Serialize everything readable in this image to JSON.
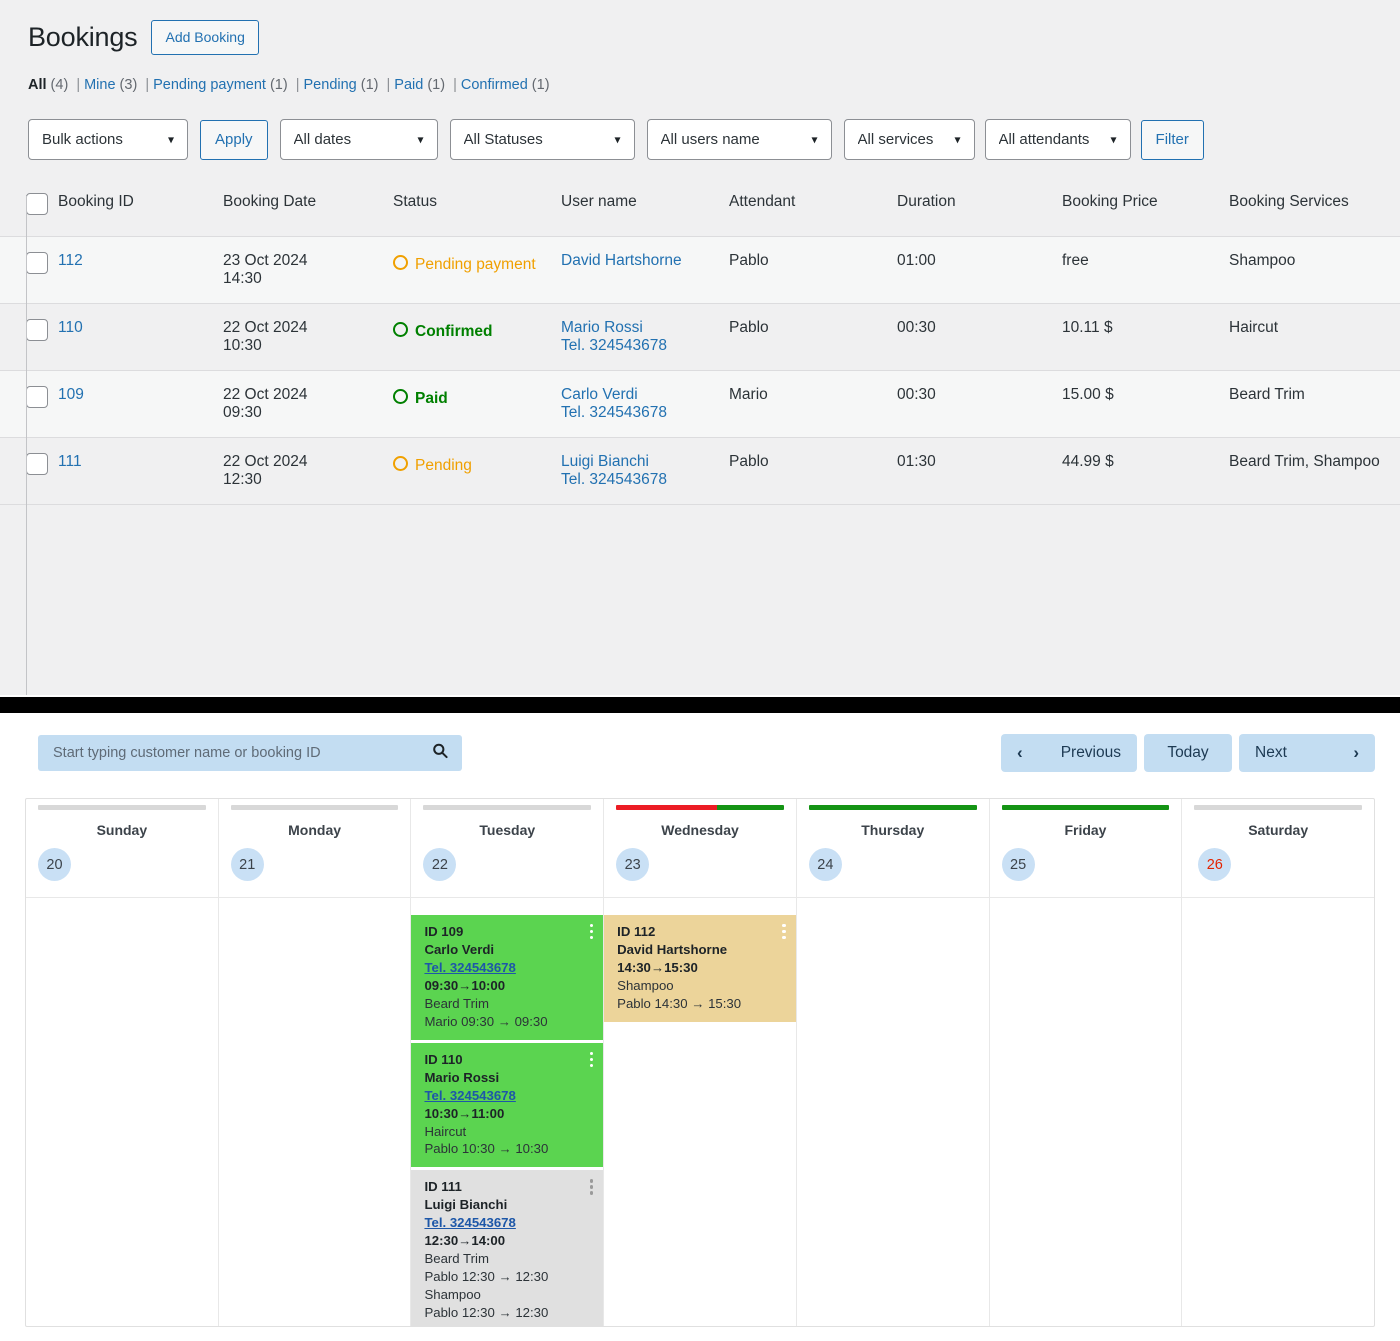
{
  "header": {
    "title": "Bookings",
    "add_button": "Add Booking"
  },
  "views": {
    "items": [
      {
        "label": "All",
        "count": "(4)",
        "current": true
      },
      {
        "label": "Mine",
        "count": "(3)",
        "current": false
      },
      {
        "label": "Pending payment",
        "count": "(1)",
        "current": false
      },
      {
        "label": "Pending",
        "count": "(1)",
        "current": false
      },
      {
        "label": "Paid",
        "count": "(1)",
        "current": false
      },
      {
        "label": "Confirmed",
        "count": "(1)",
        "current": false
      }
    ],
    "separator": "|"
  },
  "toolbar": {
    "bulk_actions": "Bulk actions",
    "apply": "Apply",
    "all_dates": "All dates",
    "all_statuses": "All Statuses",
    "all_users": "All users name",
    "all_services": "All services",
    "all_attendants": "All attendants",
    "filter": "Filter",
    "caret_icon": "chevron-down-icon"
  },
  "table": {
    "columns": [
      "Booking ID",
      "Booking Date",
      "Status",
      "User name",
      "Attendant",
      "Duration",
      "Booking Price",
      "Booking Services"
    ],
    "rows": [
      {
        "id": "112",
        "date_day": "23 Oct 2024",
        "date_time": "14:30",
        "status": "Pending payment",
        "status_kind": "pending",
        "user": "David Hartshorne",
        "tel": "",
        "attendant": "Pablo",
        "duration": "01:00",
        "price": "free",
        "services": "Shampoo"
      },
      {
        "id": "110",
        "date_day": "22 Oct 2024",
        "date_time": "10:30",
        "status": "Confirmed",
        "status_kind": "confirmed",
        "user": "Mario Rossi",
        "tel": "Tel. 324543678",
        "attendant": "Pablo",
        "duration": "00:30",
        "price": "10.11 $",
        "services": "Haircut"
      },
      {
        "id": "109",
        "date_day": "22 Oct 2024",
        "date_time": "09:30",
        "status": "Paid",
        "status_kind": "paid",
        "user": "Carlo Verdi",
        "tel": "Tel. 324543678",
        "attendant": "Mario",
        "duration": "00:30",
        "price": "15.00 $",
        "services": "Beard Trim"
      },
      {
        "id": "111",
        "date_day": "22 Oct 2024",
        "date_time": "12:30",
        "status": "Pending",
        "status_kind": "pending",
        "user": "Luigi Bianchi",
        "tel": "Tel. 324543678",
        "attendant": "Pablo",
        "duration": "01:30",
        "price": "44.99 $",
        "services": "Beard Trim, Shampoo"
      }
    ]
  },
  "calendar": {
    "search_placeholder": "Start typing customer name or booking ID",
    "search_value": "",
    "search_icon": "search-icon",
    "nav": {
      "previous": "Previous",
      "today": "Today",
      "next": "Next",
      "prev_icon": "chevron-left-icon",
      "next_icon": "chevron-right-icon"
    },
    "days": [
      {
        "name": "Sunday",
        "num": "20",
        "is_today": false,
        "bar": [
          {
            "color": "#d8d8d8",
            "pct": 100
          }
        ]
      },
      {
        "name": "Monday",
        "num": "21",
        "is_today": false,
        "bar": [
          {
            "color": "#d8d8d8",
            "pct": 100
          }
        ]
      },
      {
        "name": "Tuesday",
        "num": "22",
        "is_today": false,
        "bar": [
          {
            "color": "#d8d8d8",
            "pct": 100
          }
        ]
      },
      {
        "name": "Wednesday",
        "num": "23",
        "is_today": false,
        "bar": [
          {
            "color": "#ec1c24",
            "pct": 60
          },
          {
            "color": "#149414",
            "pct": 40
          }
        ]
      },
      {
        "name": "Thursday",
        "num": "24",
        "is_today": false,
        "bar": [
          {
            "color": "#149414",
            "pct": 100
          }
        ]
      },
      {
        "name": "Friday",
        "num": "25",
        "is_today": false,
        "bar": [
          {
            "color": "#149414",
            "pct": 100
          }
        ]
      },
      {
        "name": "Saturday",
        "num": "26",
        "is_today": true,
        "bar": [
          {
            "color": "#d8d8d8",
            "pct": 100
          }
        ]
      }
    ],
    "events": {
      "tuesday": [
        {
          "id_label": "ID 109",
          "customer": "Carlo Verdi",
          "tel": "Tel. 324543678",
          "time_range": "09:30→10:00",
          "color": "green",
          "services": [
            {
              "name": "Beard Trim",
              "attendant_line": "Mario 09:30 → 09:30"
            }
          ]
        },
        {
          "id_label": "ID 110",
          "customer": "Mario Rossi",
          "tel": "Tel. 324543678",
          "time_range": "10:30→11:00",
          "color": "green",
          "services": [
            {
              "name": "Haircut",
              "attendant_line": "Pablo 10:30 → 10:30"
            }
          ]
        },
        {
          "id_label": "ID 111",
          "customer": "Luigi Bianchi",
          "tel": "Tel. 324543678",
          "time_range": "12:30→14:00",
          "color": "gray",
          "services": [
            {
              "name": "Beard Trim",
              "attendant_line": "Pablo 12:30 → 12:30"
            },
            {
              "name": "Shampoo",
              "attendant_line": "Pablo 12:30 → 12:30"
            }
          ]
        }
      ],
      "wednesday": [
        {
          "id_label": "ID 112",
          "customer": "David Hartshorne",
          "tel": "",
          "time_range": "14:30→15:30",
          "color": "tan",
          "services": [
            {
              "name": "Shampoo",
              "attendant_line": "Pablo 14:30 → 15:30"
            }
          ]
        }
      ]
    },
    "menu_icon": "kebab-menu-icon"
  },
  "colors": {
    "link": "#2271b1",
    "pending": "#f0a000",
    "success": "#008000",
    "event_green": "#5bd450",
    "event_tan": "#ecd49a",
    "event_gray": "#e0e0e0",
    "bar_red": "#ec1c24",
    "bar_green": "#149414",
    "today_red": "#e32400"
  }
}
